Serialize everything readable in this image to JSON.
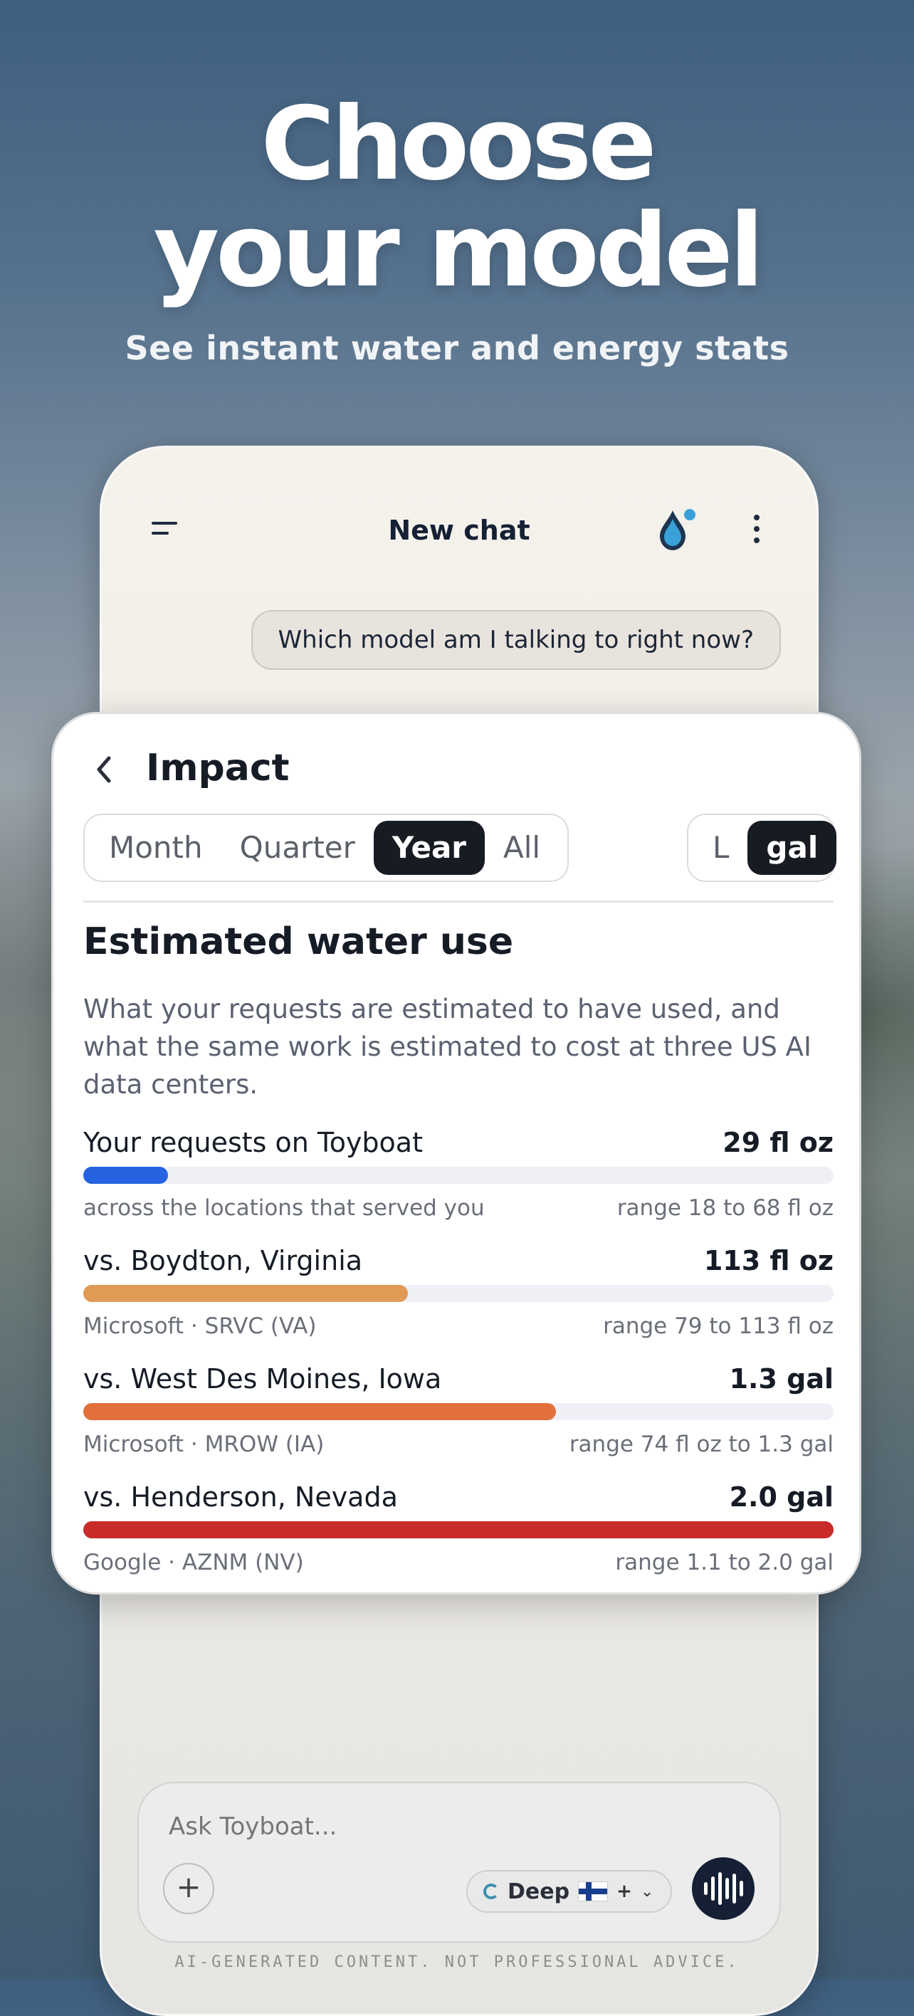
{
  "hero": {
    "title_line1": "Choose",
    "title_line2": "your model",
    "subtitle": "See instant water and energy stats"
  },
  "chat": {
    "title": "New chat",
    "user_message": "Which model am I talking to right now?",
    "input_placeholder": "Ask Toyboat...",
    "plus_label": "+",
    "model_label": "Deep",
    "model_plus": "+",
    "disclaimer": "AI-GENERATED CONTENT. NOT PROFESSIONAL ADVICE."
  },
  "impact": {
    "title": "Impact",
    "periods": [
      "Month",
      "Quarter",
      "Year",
      "All"
    ],
    "selected_period": "Year",
    "units": [
      "L",
      "gal"
    ],
    "selected_unit": "gal",
    "section_title": "Estimated water use",
    "description": "What your requests are estimated to have used, and what the same work is estimated to cost at three US AI data centers.",
    "rows": [
      {
        "name": "Your requests on Toyboat",
        "value": "29 fl oz",
        "sub": "across the locations that served you",
        "range": "range 18 to 68 fl oz",
        "fraction": 0.113,
        "color": "#2563e0"
      },
      {
        "name": "vs. Boydton, Virginia",
        "value": "113 fl oz",
        "sub": "Microsoft · SRVC (VA)",
        "range": "range 79 to 113 fl oz",
        "fraction": 0.433,
        "color": "#e09a55"
      },
      {
        "name": "vs. West Des Moines, Iowa",
        "value": "1.3 gal",
        "sub": "Microsoft · MROW (IA)",
        "range": "range 74 fl oz to 1.3 gal",
        "fraction": 0.63,
        "color": "#e2703c"
      },
      {
        "name": "vs. Henderson, Nevada",
        "value": "2.0 gal",
        "sub": "Google · AZNM (NV)",
        "range": "range 1.1 to 2.0 gal",
        "fraction": 1.0,
        "color": "#c92b2b"
      }
    ]
  }
}
